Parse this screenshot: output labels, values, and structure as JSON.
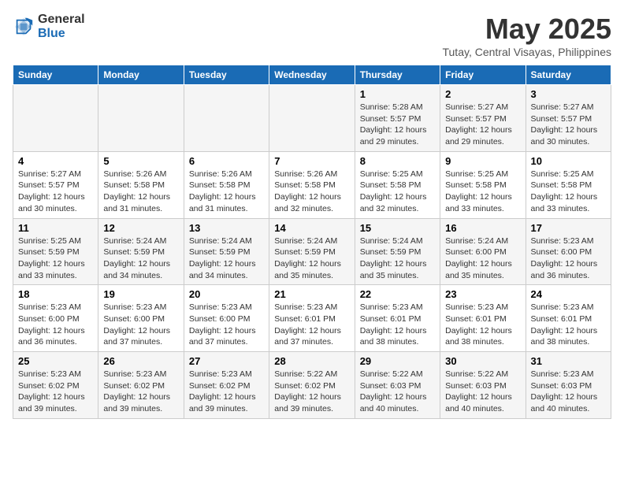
{
  "header": {
    "logo_general": "General",
    "logo_blue": "Blue",
    "title": "May 2025",
    "subtitle": "Tutay, Central Visayas, Philippines"
  },
  "weekdays": [
    "Sunday",
    "Monday",
    "Tuesday",
    "Wednesday",
    "Thursday",
    "Friday",
    "Saturday"
  ],
  "weeks": [
    [
      {
        "day": "",
        "text": ""
      },
      {
        "day": "",
        "text": ""
      },
      {
        "day": "",
        "text": ""
      },
      {
        "day": "",
        "text": ""
      },
      {
        "day": "1",
        "text": "Sunrise: 5:28 AM\nSunset: 5:57 PM\nDaylight: 12 hours\nand 29 minutes."
      },
      {
        "day": "2",
        "text": "Sunrise: 5:27 AM\nSunset: 5:57 PM\nDaylight: 12 hours\nand 29 minutes."
      },
      {
        "day": "3",
        "text": "Sunrise: 5:27 AM\nSunset: 5:57 PM\nDaylight: 12 hours\nand 30 minutes."
      }
    ],
    [
      {
        "day": "4",
        "text": "Sunrise: 5:27 AM\nSunset: 5:57 PM\nDaylight: 12 hours\nand 30 minutes."
      },
      {
        "day": "5",
        "text": "Sunrise: 5:26 AM\nSunset: 5:58 PM\nDaylight: 12 hours\nand 31 minutes."
      },
      {
        "day": "6",
        "text": "Sunrise: 5:26 AM\nSunset: 5:58 PM\nDaylight: 12 hours\nand 31 minutes."
      },
      {
        "day": "7",
        "text": "Sunrise: 5:26 AM\nSunset: 5:58 PM\nDaylight: 12 hours\nand 32 minutes."
      },
      {
        "day": "8",
        "text": "Sunrise: 5:25 AM\nSunset: 5:58 PM\nDaylight: 12 hours\nand 32 minutes."
      },
      {
        "day": "9",
        "text": "Sunrise: 5:25 AM\nSunset: 5:58 PM\nDaylight: 12 hours\nand 33 minutes."
      },
      {
        "day": "10",
        "text": "Sunrise: 5:25 AM\nSunset: 5:58 PM\nDaylight: 12 hours\nand 33 minutes."
      }
    ],
    [
      {
        "day": "11",
        "text": "Sunrise: 5:25 AM\nSunset: 5:59 PM\nDaylight: 12 hours\nand 33 minutes."
      },
      {
        "day": "12",
        "text": "Sunrise: 5:24 AM\nSunset: 5:59 PM\nDaylight: 12 hours\nand 34 minutes."
      },
      {
        "day": "13",
        "text": "Sunrise: 5:24 AM\nSunset: 5:59 PM\nDaylight: 12 hours\nand 34 minutes."
      },
      {
        "day": "14",
        "text": "Sunrise: 5:24 AM\nSunset: 5:59 PM\nDaylight: 12 hours\nand 35 minutes."
      },
      {
        "day": "15",
        "text": "Sunrise: 5:24 AM\nSunset: 5:59 PM\nDaylight: 12 hours\nand 35 minutes."
      },
      {
        "day": "16",
        "text": "Sunrise: 5:24 AM\nSunset: 6:00 PM\nDaylight: 12 hours\nand 35 minutes."
      },
      {
        "day": "17",
        "text": "Sunrise: 5:23 AM\nSunset: 6:00 PM\nDaylight: 12 hours\nand 36 minutes."
      }
    ],
    [
      {
        "day": "18",
        "text": "Sunrise: 5:23 AM\nSunset: 6:00 PM\nDaylight: 12 hours\nand 36 minutes."
      },
      {
        "day": "19",
        "text": "Sunrise: 5:23 AM\nSunset: 6:00 PM\nDaylight: 12 hours\nand 37 minutes."
      },
      {
        "day": "20",
        "text": "Sunrise: 5:23 AM\nSunset: 6:00 PM\nDaylight: 12 hours\nand 37 minutes."
      },
      {
        "day": "21",
        "text": "Sunrise: 5:23 AM\nSunset: 6:01 PM\nDaylight: 12 hours\nand 37 minutes."
      },
      {
        "day": "22",
        "text": "Sunrise: 5:23 AM\nSunset: 6:01 PM\nDaylight: 12 hours\nand 38 minutes."
      },
      {
        "day": "23",
        "text": "Sunrise: 5:23 AM\nSunset: 6:01 PM\nDaylight: 12 hours\nand 38 minutes."
      },
      {
        "day": "24",
        "text": "Sunrise: 5:23 AM\nSunset: 6:01 PM\nDaylight: 12 hours\nand 38 minutes."
      }
    ],
    [
      {
        "day": "25",
        "text": "Sunrise: 5:23 AM\nSunset: 6:02 PM\nDaylight: 12 hours\nand 39 minutes."
      },
      {
        "day": "26",
        "text": "Sunrise: 5:23 AM\nSunset: 6:02 PM\nDaylight: 12 hours\nand 39 minutes."
      },
      {
        "day": "27",
        "text": "Sunrise: 5:23 AM\nSunset: 6:02 PM\nDaylight: 12 hours\nand 39 minutes."
      },
      {
        "day": "28",
        "text": "Sunrise: 5:22 AM\nSunset: 6:02 PM\nDaylight: 12 hours\nand 39 minutes."
      },
      {
        "day": "29",
        "text": "Sunrise: 5:22 AM\nSunset: 6:03 PM\nDaylight: 12 hours\nand 40 minutes."
      },
      {
        "day": "30",
        "text": "Sunrise: 5:22 AM\nSunset: 6:03 PM\nDaylight: 12 hours\nand 40 minutes."
      },
      {
        "day": "31",
        "text": "Sunrise: 5:23 AM\nSunset: 6:03 PM\nDaylight: 12 hours\nand 40 minutes."
      }
    ]
  ]
}
